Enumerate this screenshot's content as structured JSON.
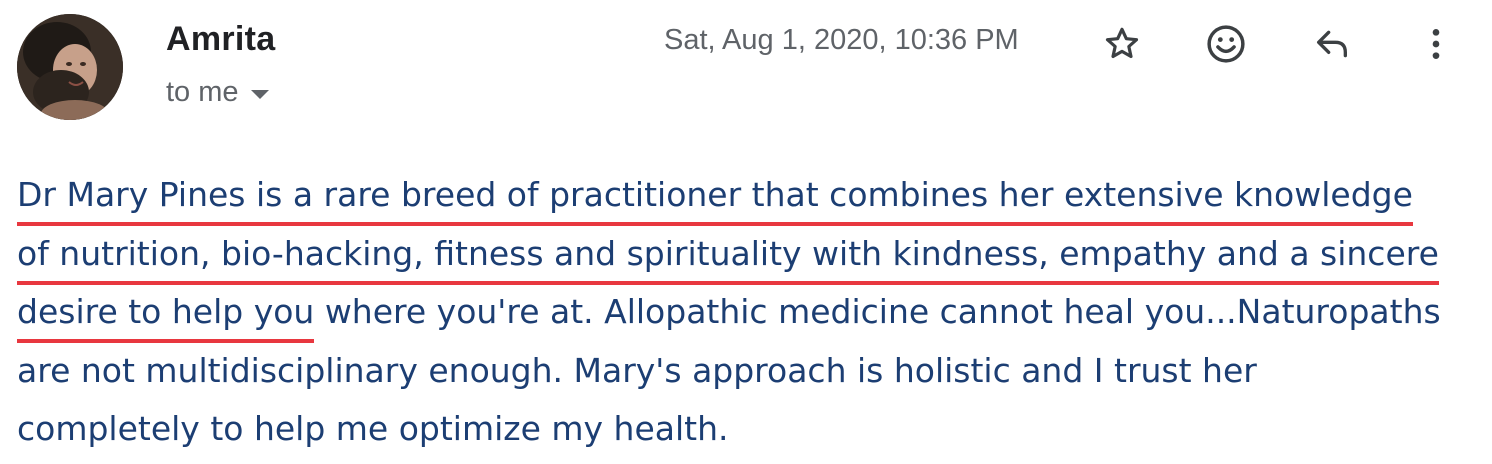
{
  "sender": {
    "name": "Amrita",
    "recipient_label": "to me"
  },
  "timestamp": "Sat, Aug 1, 2020, 10:36 PM",
  "actions": {
    "star": "star-icon",
    "emoji": "emoji-icon",
    "reply": "reply-icon",
    "more": "more-vert-icon"
  },
  "body": {
    "lines": [
      {
        "highlighted": "Dr Mary Pines is a rare breed of practitioner that combines her extensive knowledge",
        "rest": ""
      },
      {
        "highlighted": "of nutrition, bio-hacking, fitness and spirituality with kindness, empathy and a sincere",
        "rest": ""
      },
      {
        "highlighted": "desire to help you",
        "rest": " where you're at. Allopathic medicine cannot heal you...Naturopaths"
      },
      {
        "highlighted": "",
        "rest": "are not multidisciplinary enough.  Mary's approach is holistic and I trust her"
      },
      {
        "highlighted": "",
        "rest": "completely to help me optimize my health."
      }
    ]
  },
  "colors": {
    "body_text": "#1c3e73",
    "underline": "#e8373f",
    "secondary_text": "#5f6368",
    "name_text": "#202124"
  }
}
